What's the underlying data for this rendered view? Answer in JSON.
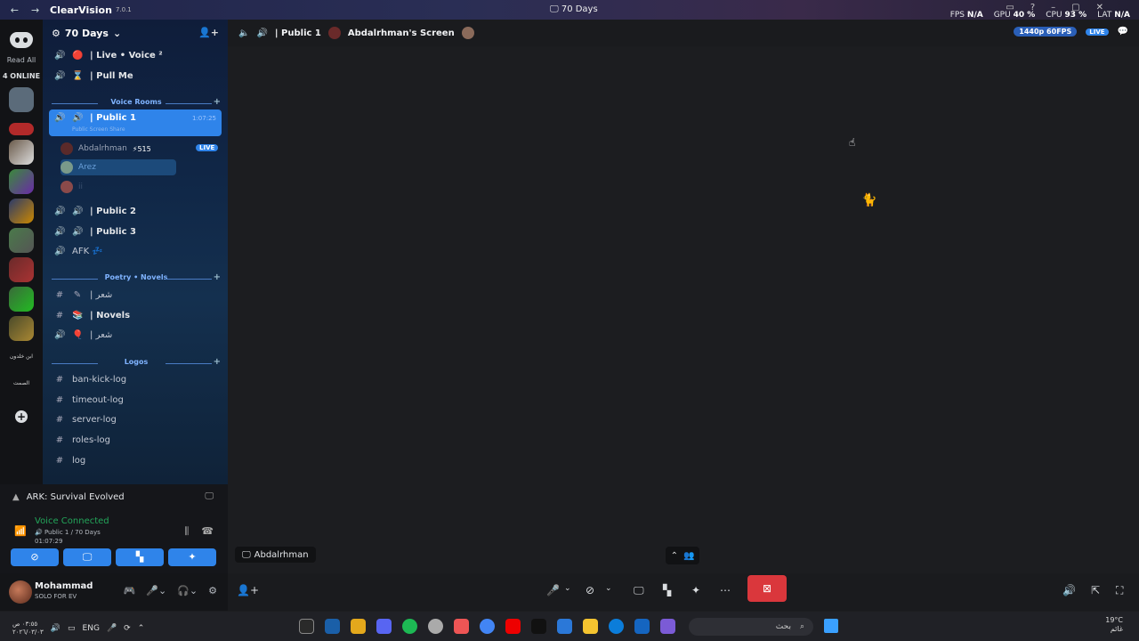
{
  "titlebar": {
    "app_name": "ClearVision",
    "version": "7.0.1",
    "window_title": "70 Days"
  },
  "servers": {
    "read_all": "Read All",
    "online": "4 ONLINE",
    "server_texts": [
      "ابن خلدون",
      "الصمت"
    ],
    "server_colors": [
      "#5b6b7a",
      "#b22a2a",
      "#6a5a4a",
      "#3a8a3a",
      "#2a3a6a",
      "#4a7a4a",
      "#6a2a2a",
      "#3a6a3a",
      "#4a4a2a"
    ]
  },
  "sidebar": {
    "server_name": "70 Days",
    "top_channels": [
      {
        "label": "| Live • Voice ²",
        "icon": "🔴"
      },
      {
        "label": "| Pull Me",
        "icon": "⌛"
      }
    ],
    "cat_voice": "Voice Rooms",
    "active_channel": {
      "label": "| Public 1",
      "time": "1:07:25",
      "sub": "Public Screen Share"
    },
    "voice_users": [
      {
        "name": "Abdalrhman",
        "badge": "⚡515",
        "live": "LIVE"
      },
      {
        "name": "Arez"
      },
      {
        "name": "ii"
      }
    ],
    "voice_channels": [
      {
        "label": "| Public 2"
      },
      {
        "label": "| Public 3"
      },
      {
        "label": "AFK 💤"
      }
    ],
    "cat_poetry": "Poetry • Novels",
    "poetry_channels": [
      {
        "label": "| شعر",
        "icon": "✎"
      },
      {
        "label": "| Novels",
        "icon": "📚"
      },
      {
        "label": "| شعر",
        "icon": "🎈"
      }
    ],
    "cat_logs": "Logos",
    "log_channels": [
      "ban-kick-log",
      "timeout-log",
      "server-log",
      "roles-log",
      "log"
    ]
  },
  "activity": {
    "game": "ARK: Survival Evolved"
  },
  "voice_panel": {
    "status": "Voice Connected",
    "channel": "Public 1 / 70 Days",
    "time": "01:07:29"
  },
  "user": {
    "name": "Mohammad",
    "status": "SOLO FOR EV"
  },
  "stage": {
    "channel": "| Public 1",
    "screen_title": "Abdalrhman's Screen",
    "resolution": "1440p 60FPS",
    "live": "LIVE",
    "name_chip": "Abdalrhman"
  },
  "stats": {
    "fps_label": "FPS",
    "fps_value": "N/A",
    "gpu_label": "GPU",
    "gpu_value": "40 %",
    "cpu_label": "CPU",
    "cpu_value": "93 %",
    "lat_label": "LAT",
    "lat_value": "N/A"
  },
  "taskbar": {
    "lang": "ENG",
    "time": "٠٣:٥٥ ص",
    "date": "٢٠٢٦/٠٣/٠٣",
    "search_placeholder": "بحث",
    "temp": "19°C",
    "weather": "غائم",
    "app_colors": [
      "#2a2a2a",
      "#1a5fa8",
      "#e3a81c",
      "#5865f2",
      "#1db954",
      "#aaaaaa",
      "#e55",
      "#4285f4",
      "#e00",
      "#111",
      "#2b78d8",
      "#f4c430",
      "#0b7dda",
      "#1565c0",
      "#7b5bd6"
    ]
  }
}
